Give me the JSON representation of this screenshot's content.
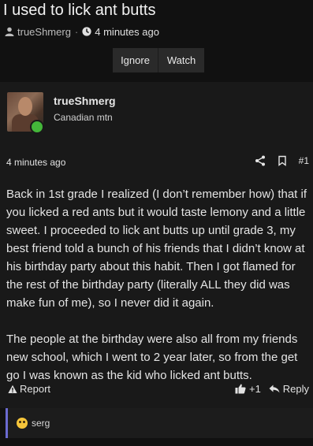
{
  "topic": {
    "title": "I used to lick ant butts",
    "author": "trueShmerg",
    "separator": "·",
    "time": "4 minutes ago"
  },
  "buttons": {
    "ignore": "Ignore",
    "watch": "Watch"
  },
  "post": {
    "username": "trueShmerg",
    "user_title": "Canadian mtn",
    "time": "4 minutes ago",
    "post_number": "#1",
    "paragraphs": [
      "Back in 1st grade I realized (I don’t remember how) that if you licked a red ants but it would taste lemony and a little sweet. I proceeded to lick ant butts up until grade 3, my best friend told a bunch of his friends that I didn’t know at his birthday party about this habit. Then I got flamed for the rest of the birthday party (literally ALL they did was make fun of me), so I never did it again.",
      "The people at the birthday were also all from my friends new school, which I went to 2 year later, so from the get go I was known as the kid who licked ant butts."
    ],
    "report_label": "Report",
    "like_count": "+1",
    "reply_label": "Reply"
  },
  "reactions": {
    "user": "serg"
  },
  "icons": {
    "user": "user-icon",
    "clock": "clock-icon",
    "share": "share-icon",
    "bookmark": "bookmark-icon",
    "warning": "warning-icon",
    "thumbs_up": "thumbs-up-icon",
    "reply": "reply-icon",
    "emoji": "emoji-icon"
  },
  "colors": {
    "background": "#111111",
    "post_background": "#191919",
    "button_background": "#2a2a2a",
    "online": "#44b63a",
    "reaction_accent": "#6b6bd1"
  }
}
